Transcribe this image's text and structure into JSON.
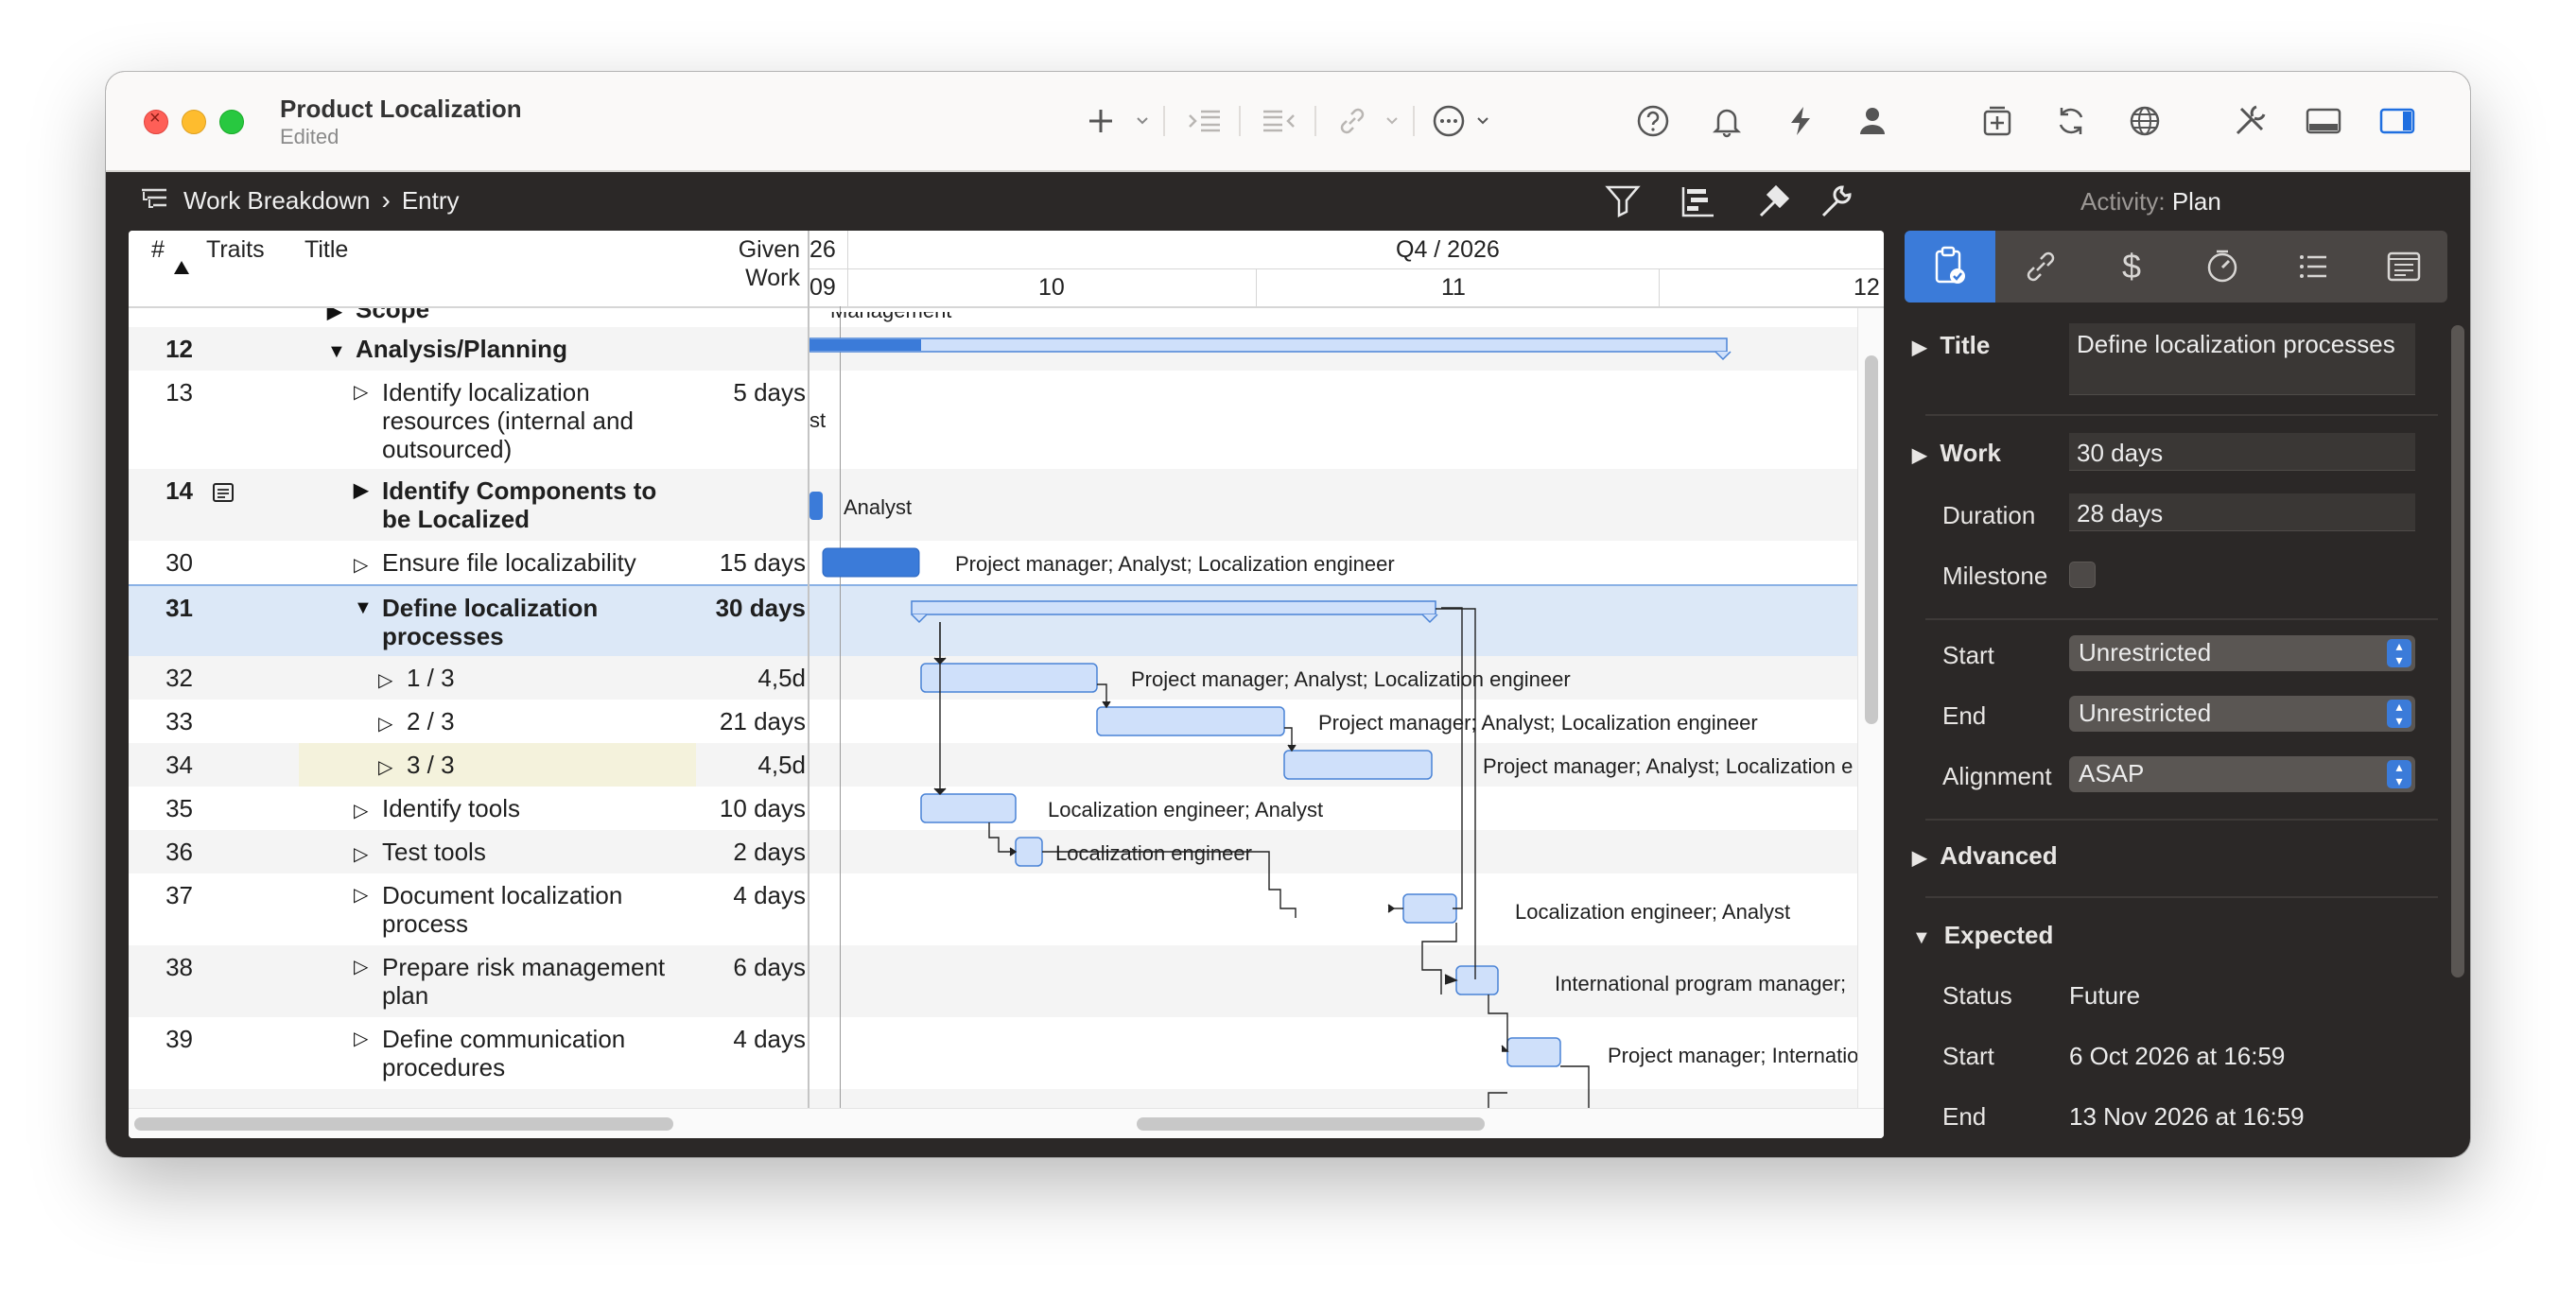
{
  "window": {
    "title": "Product Localization",
    "subtitle": "Edited"
  },
  "header": {
    "breadcrumb": [
      "Work Breakdown",
      "Entry"
    ],
    "activity_label": "Activity:",
    "activity_value": "Plan"
  },
  "columns": {
    "num": "#",
    "traits": "Traits",
    "title": "Title",
    "work_line1": "Given",
    "work_line2": "Work"
  },
  "timeline": {
    "quarter": "Q4 / 2026",
    "left_top": "26",
    "left_bottom": "09",
    "weeks": [
      "10",
      "11",
      "12"
    ]
  },
  "rows": [
    {
      "num": "",
      "title": "Scope",
      "work": ""
    },
    {
      "num": "12",
      "title": "Analysis/Planning",
      "work": ""
    },
    {
      "num": "13",
      "title": "Identify localization resources (internal and outsourced)",
      "work": "5 days"
    },
    {
      "num": "14",
      "title": "Identify Components to be Localized",
      "work": ""
    },
    {
      "num": "30",
      "title": "Ensure file localizability",
      "work": "15 days"
    },
    {
      "num": "31",
      "title": "Define localization processes",
      "work": "30 days"
    },
    {
      "num": "32",
      "title": "1 / 3",
      "work": "4,5d"
    },
    {
      "num": "33",
      "title": "2 / 3",
      "work": "21 days"
    },
    {
      "num": "34",
      "title": "3 / 3",
      "work": "4,5d"
    },
    {
      "num": "35",
      "title": "Identify tools",
      "work": "10 days"
    },
    {
      "num": "36",
      "title": "Test tools",
      "work": "2 days"
    },
    {
      "num": "37",
      "title": "Document localization process",
      "work": "4 days"
    },
    {
      "num": "38",
      "title": "Prepare risk management plan",
      "work": "6 days"
    },
    {
      "num": "39",
      "title": "Define communication procedures",
      "work": "4 days"
    }
  ],
  "gantt_labels": {
    "scope": "Management",
    "r13": "st",
    "r14": "Analyst",
    "r30": "Project manager; Analyst; Localization engineer",
    "r32": "Project manager; Analyst; Localization engineer",
    "r33": "Project manager; Analyst; Localization engineer",
    "r34": "Project manager; Analyst; Localization e",
    "r35": "Localization engineer; Analyst",
    "r36": "Localization engineer",
    "r37": "Localization engineer; Analyst",
    "r38": "International program manager;",
    "r39": "Project manager; Internatio"
  },
  "inspector": {
    "title_label": "Title",
    "title_value": "Define localization processes",
    "work_label": "Work",
    "work_value": "30 days",
    "duration_label": "Duration",
    "duration_value": "28 days",
    "milestone_label": "Milestone",
    "start_label": "Start",
    "start_value": "Unrestricted",
    "end_label": "End",
    "end_value": "Unrestricted",
    "alignment_label": "Alignment",
    "alignment_value": "ASAP",
    "advanced_label": "Advanced",
    "expected_label": "Expected",
    "status_label": "Status",
    "status_value": "Future",
    "exp_start_label": "Start",
    "exp_start_value": "6 Oct 2026 at 16:59",
    "exp_end_label": "End",
    "exp_end_value": "13 Nov 2026 at 16:59"
  },
  "colors": {
    "accent": "#3b7bd9",
    "bar_fill": "#cfe0fa",
    "bar_stroke": "#4a83d6",
    "selection": "#dce8f7"
  }
}
